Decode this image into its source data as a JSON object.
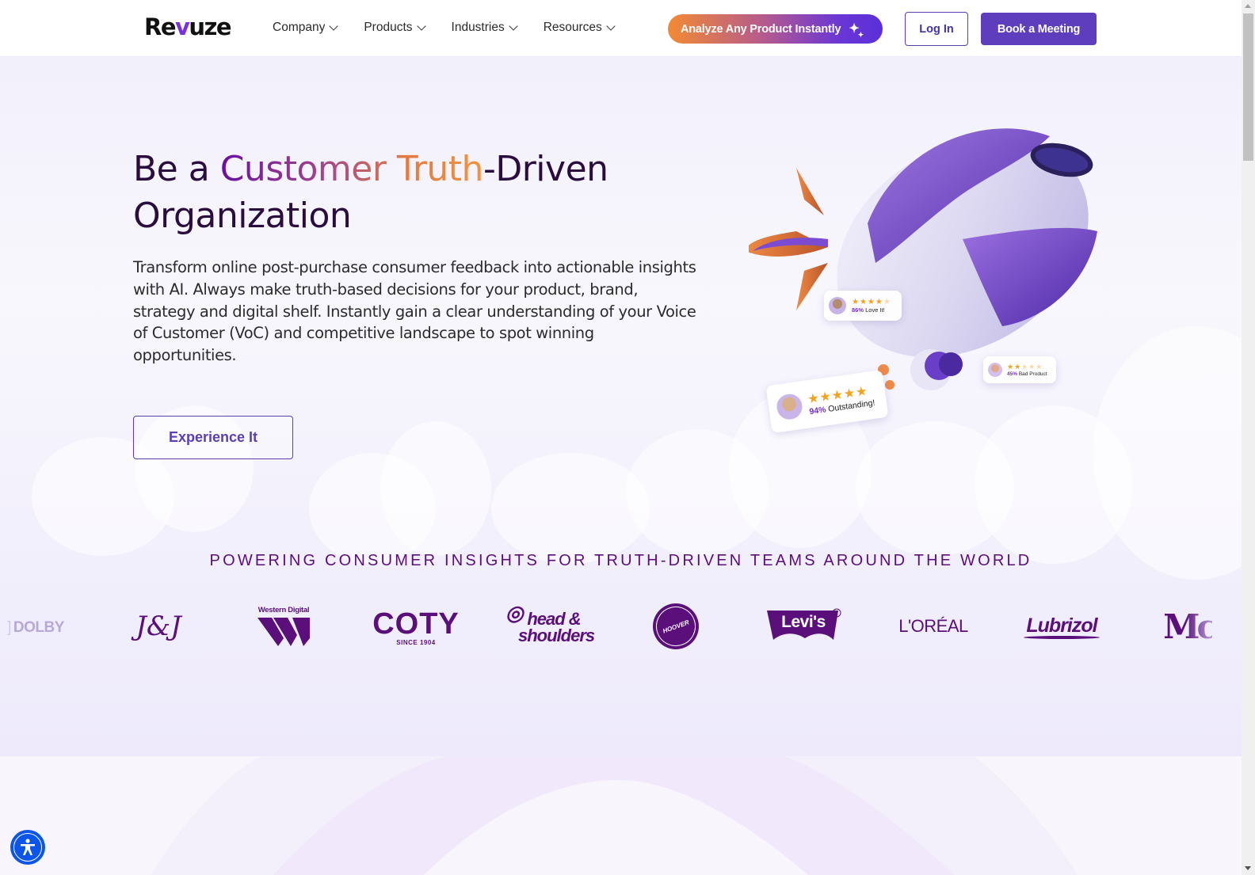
{
  "header": {
    "logo": {
      "prefix": "Re",
      "accent": "v",
      "suffix": "uze"
    },
    "nav": [
      {
        "label": "Company"
      },
      {
        "label": "Products"
      },
      {
        "label": "Industries"
      },
      {
        "label": "Resources"
      }
    ],
    "cta_analyze": "Analyze Any Product Instantly",
    "login": "Log In",
    "book_meeting": "Book a Meeting"
  },
  "hero": {
    "headline": {
      "part1": "Be a ",
      "highlight": "Customer Truth",
      "part2": "-Driven",
      "line2": "Organization"
    },
    "subtext": "Transform online post-purchase consumer feedback into actionable insights with AI. Always make truth-based decisions for your product, brand, strategy and digital shelf. Instantly gain a clear understanding of your Voice of Customer (VoC) and competitive landscape to spot winning opportunities.",
    "cta": "Experience It",
    "reviews": [
      {
        "percent": "86%",
        "label": "Love It!",
        "rating": 4
      },
      {
        "percent": "45%",
        "label": "Bad Product",
        "rating": 2
      },
      {
        "percent": "94%",
        "label": "Outstanding!",
        "rating": 5
      }
    ]
  },
  "brands": {
    "title": "POWERING CONSUMER INSIGHTS FOR TRUTH-DRIVEN TEAMS AROUND THE WORLD",
    "logos": [
      {
        "name": "DOLBY"
      },
      {
        "name": "J&J"
      },
      {
        "name": "Western Digital"
      },
      {
        "name": "COTY",
        "tagline": "SINCE 1904"
      },
      {
        "name": "head & shoulders"
      },
      {
        "name": "HOOVER"
      },
      {
        "name": "Levi's"
      },
      {
        "name": "L'ORÉAL"
      },
      {
        "name": "Lubrizol"
      },
      {
        "name": "Mc"
      }
    ]
  },
  "colors": {
    "brand_purple": "#5f3ebd",
    "heading_dark": "#2a0c3f",
    "logo_purple": "#5a0f7a",
    "accent_orange": "#f6923a",
    "a11y_blue": "#0b55e8"
  },
  "accessibility": {
    "icon": "accessibility-icon"
  }
}
